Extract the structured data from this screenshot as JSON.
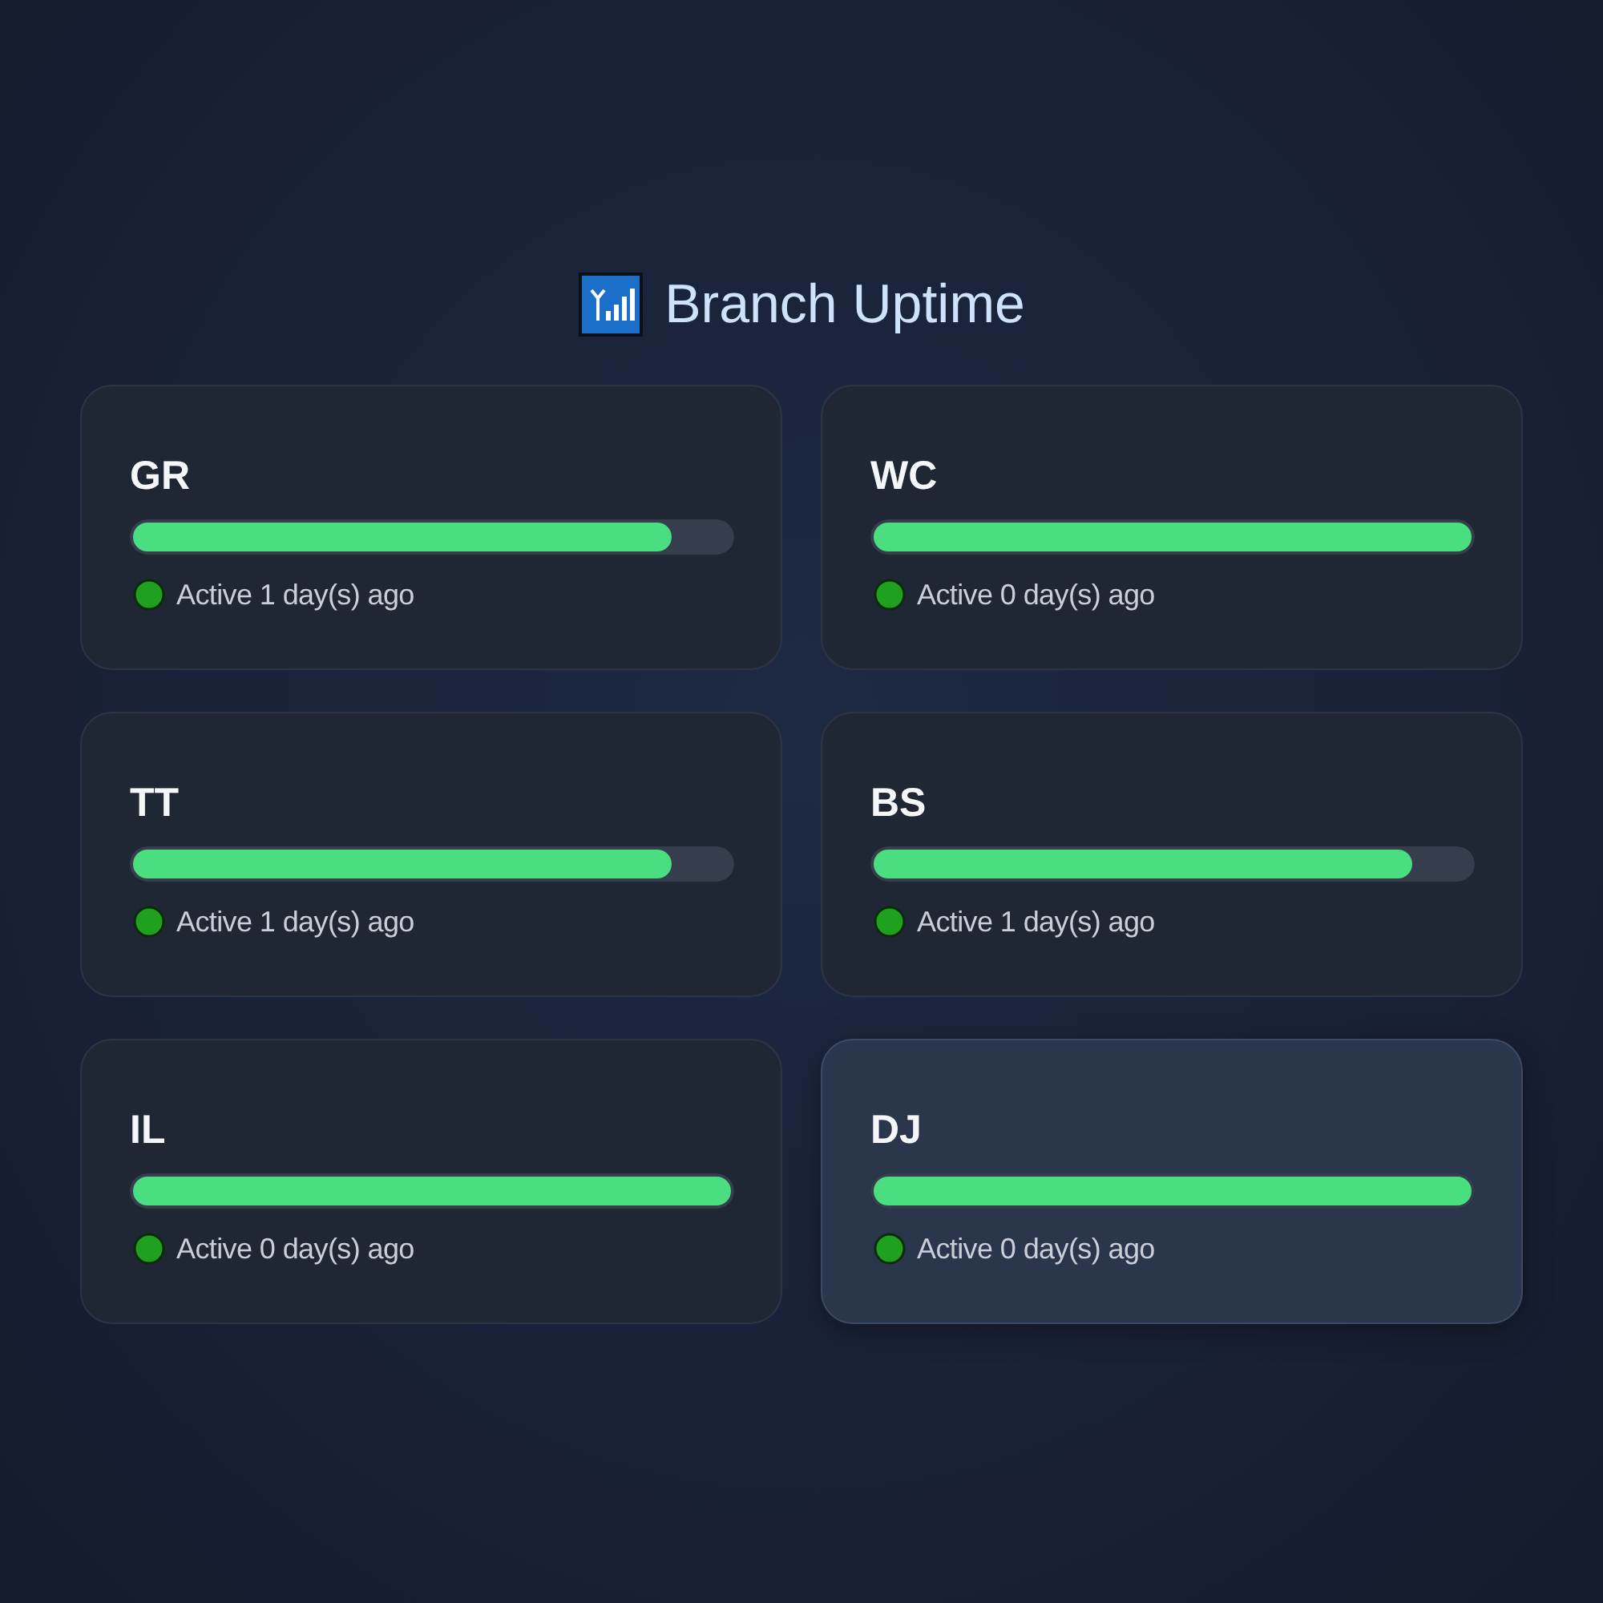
{
  "header": {
    "title": "Branch Uptime"
  },
  "branches": [
    {
      "name": "GR",
      "level": 0.9,
      "status": "Active 1 day(s) ago",
      "hovered": false
    },
    {
      "name": "WC",
      "level": 1,
      "status": "Active 0 day(s) ago",
      "hovered": false
    },
    {
      "name": "TT",
      "level": 0.9,
      "status": "Active 1 day(s) ago",
      "hovered": false
    },
    {
      "name": "BS",
      "level": 0.9,
      "status": "Active 1 day(s) ago",
      "hovered": false
    },
    {
      "name": "IL",
      "level": 1,
      "status": "Active 0 day(s) ago",
      "hovered": false
    },
    {
      "name": "DJ",
      "level": 1,
      "status": "Active 0 day(s) ago",
      "hovered": true
    }
  ]
}
